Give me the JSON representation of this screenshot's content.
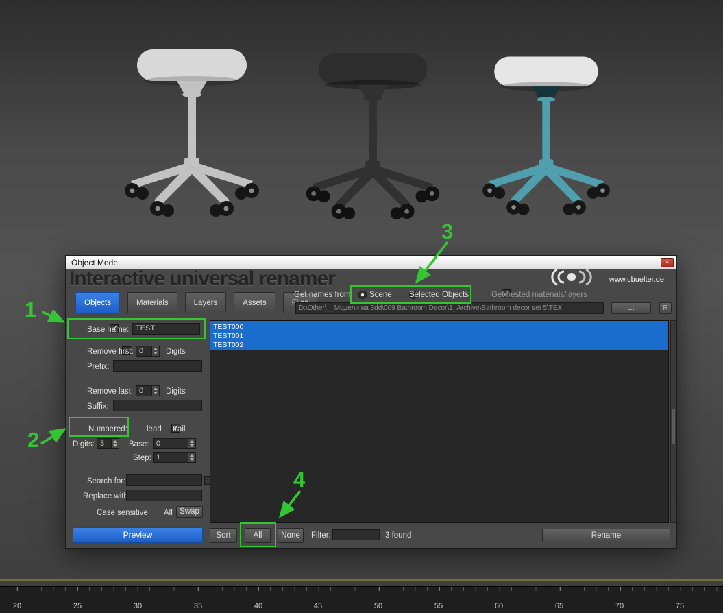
{
  "window": {
    "title": "Object Mode",
    "close_glyph": "×",
    "header_title": "Interactive universal renamer",
    "website": "www.cbuelter.de"
  },
  "tabs": [
    {
      "label": "Objects"
    },
    {
      "label": "Materials"
    },
    {
      "label": "Layers"
    },
    {
      "label": "Assets"
    },
    {
      "label": "Files"
    }
  ],
  "source": {
    "get_names_label": "Get names from:",
    "scene_label": "Scene",
    "selected_objects_label": "Selected Objects",
    "nested_label": "Get nested materials/layers",
    "path_value": "D:\\Other\\__Модели на 3dd\\009 Bathroom Decor\\1_Archive\\Bathroom decor set  5\\TEX",
    "browse_label": "...",
    "refresh_label": "R"
  },
  "rename_panel": {
    "base_name_label": "Base name:",
    "base_name_value": "TEST",
    "remove_first_label": "Remove first:",
    "remove_first_value": "0",
    "digits_word": "Digits",
    "prefix_label": "Prefix:",
    "prefix_value": "",
    "remove_last_label": "Remove last:",
    "remove_last_value": "0",
    "suffix_label": "Suffix:",
    "suffix_value": "",
    "numbered_label": "Numbered:",
    "lead_label": "lead",
    "trail_label": "trail",
    "digits_label": "Digits:",
    "digits_value": "3",
    "base_label": "Base:",
    "base_value": "0",
    "step_label": "Step:",
    "step_value": "1",
    "search_label": "Search for:",
    "search_value": "",
    "replace_label": "Replace with:",
    "replace_value": "",
    "case_sensitive_label": "Case sensitive",
    "all_label": "All",
    "swap_label": "Swap",
    "preview_label": "Preview"
  },
  "name_list": {
    "items": [
      "TEST000",
      "TEST001",
      "TEST002"
    ]
  },
  "footer": {
    "sort_label": "Sort",
    "all_label": "All",
    "none_label": "None",
    "filter_label": "Filter:",
    "filter_value": "",
    "found_text": "3 found",
    "rename_label": "Rename"
  },
  "annotations": {
    "num1": "1",
    "num2": "2",
    "num3": "3",
    "num4": "4",
    "highlight_color": "#34c534"
  },
  "stools": [
    {
      "name": "light gray stool",
      "seat_color": "#d8d8d8",
      "frame_color": "#c2c2c2"
    },
    {
      "name": "black stool",
      "seat_color": "#2d2d2d",
      "frame_color": "#313131"
    },
    {
      "name": "teal stool",
      "seat_color": "#e6e6e6",
      "frame_color": "#4f9fae"
    }
  ],
  "timeline": {
    "ticks": [
      "20",
      "25",
      "30",
      "35",
      "40",
      "45",
      "50",
      "55",
      "60",
      "65",
      "70",
      "75"
    ]
  },
  "colors": {
    "accent_blue": "#2f74d8",
    "selection_blue": "#1a6ccd",
    "annotation_green": "#34c534"
  }
}
